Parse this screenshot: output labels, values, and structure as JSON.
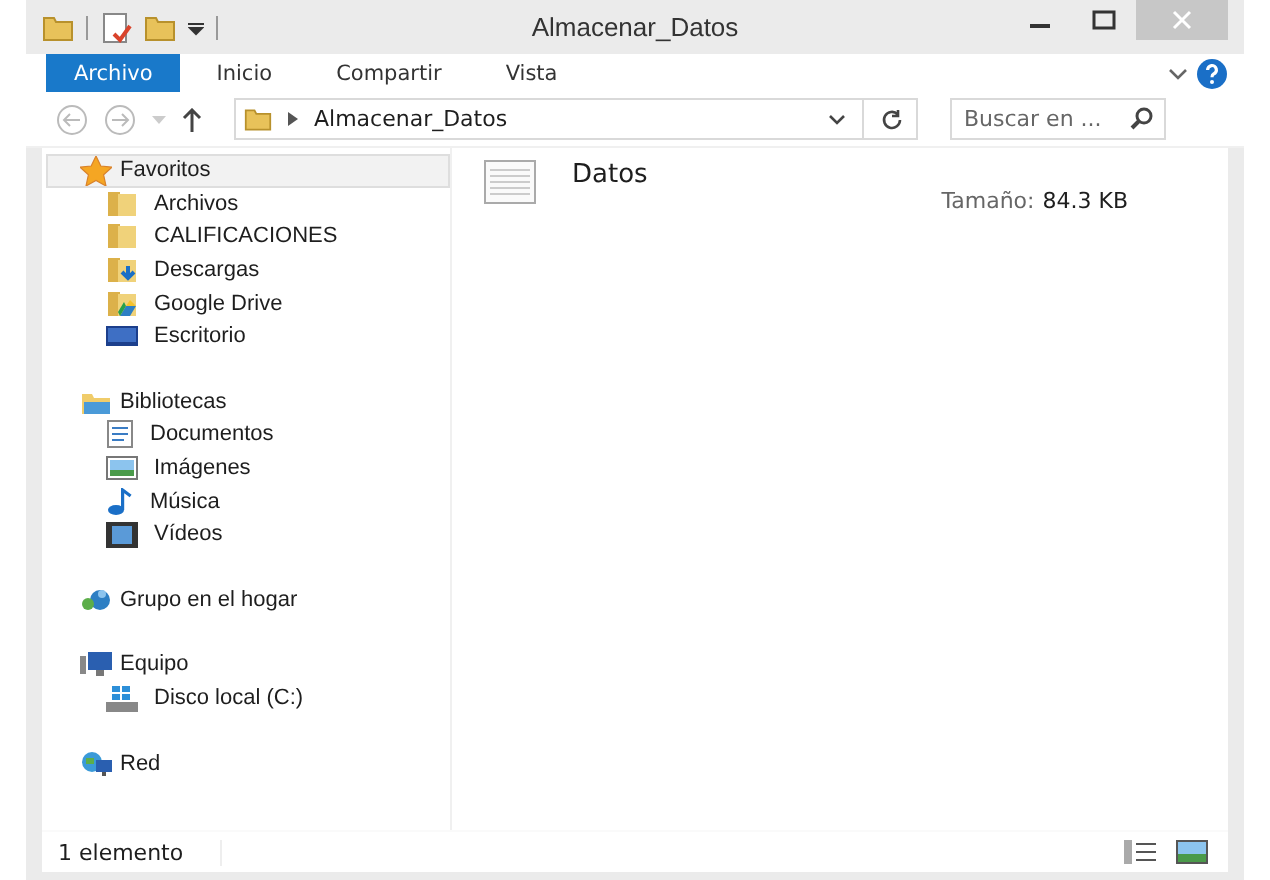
{
  "window": {
    "title": "Almacenar_Datos"
  },
  "ribbon_tabs": [
    {
      "label": "Archivo",
      "selected": true
    },
    {
      "label": "Inicio",
      "selected": false
    },
    {
      "label": "Compartir",
      "selected": false
    },
    {
      "label": "Vista",
      "selected": false
    }
  ],
  "address_bar": {
    "path": "Almacenar_Datos"
  },
  "search": {
    "placeholder": "Buscar en ..."
  },
  "sidebar": {
    "groups": [
      {
        "label": "Favoritos",
        "selected": true,
        "children": [
          {
            "label": "Archivos"
          },
          {
            "label": "CALIFICACIONES"
          },
          {
            "label": "Descargas"
          },
          {
            "label": "Google Drive"
          },
          {
            "label": "Escritorio"
          }
        ]
      },
      {
        "label": "Bibliotecas",
        "selected": false,
        "children": [
          {
            "label": "Documentos"
          },
          {
            "label": "Imágenes"
          },
          {
            "label": "Música"
          },
          {
            "label": "Vídeos"
          }
        ]
      },
      {
        "label": "Grupo en el hogar",
        "selected": false
      },
      {
        "label": "Equipo",
        "selected": false,
        "children": [
          {
            "label": "Disco local (C:)"
          }
        ]
      },
      {
        "label": "Red",
        "selected": false
      }
    ]
  },
  "files": [
    {
      "name": "Datos",
      "size_label": "Tamaño:",
      "size_value": "84.3 KB"
    }
  ],
  "status_bar": {
    "count": "1 elemento"
  }
}
